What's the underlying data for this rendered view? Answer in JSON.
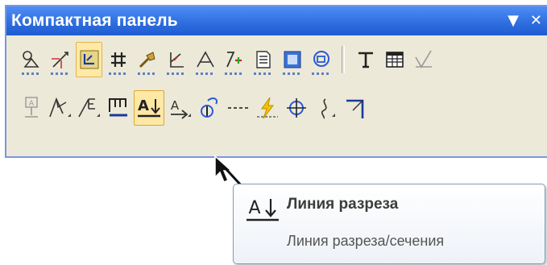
{
  "panel": {
    "title": "Компактная панель",
    "controls": {
      "menu": "▼",
      "close": "✕"
    }
  },
  "row1_icons": [
    "point-icon",
    "segment-icon",
    "auxiliary-line-icon",
    "hatch-icon",
    "tangent-icon",
    "angle-icon",
    "text-annotation-icon",
    "dimension-icon",
    "sheet-icon",
    "view-icon",
    "layer-icon",
    "text-icon",
    "table-icon",
    "roughness-icon"
  ],
  "row2_icons": [
    "base-icon",
    "leader-icon",
    "position-leader-icon",
    "mark-icon",
    "cut-line-icon",
    "view-arrow-icon",
    "leader-marking-icon",
    "axis-line-icon",
    "break-line-icon",
    "center-mark-icon",
    "wave-line-icon",
    "corner-icon"
  ],
  "tooltip": {
    "icon_label": "A",
    "title": "Линия разреза",
    "description": "Линия разреза/сечения"
  }
}
